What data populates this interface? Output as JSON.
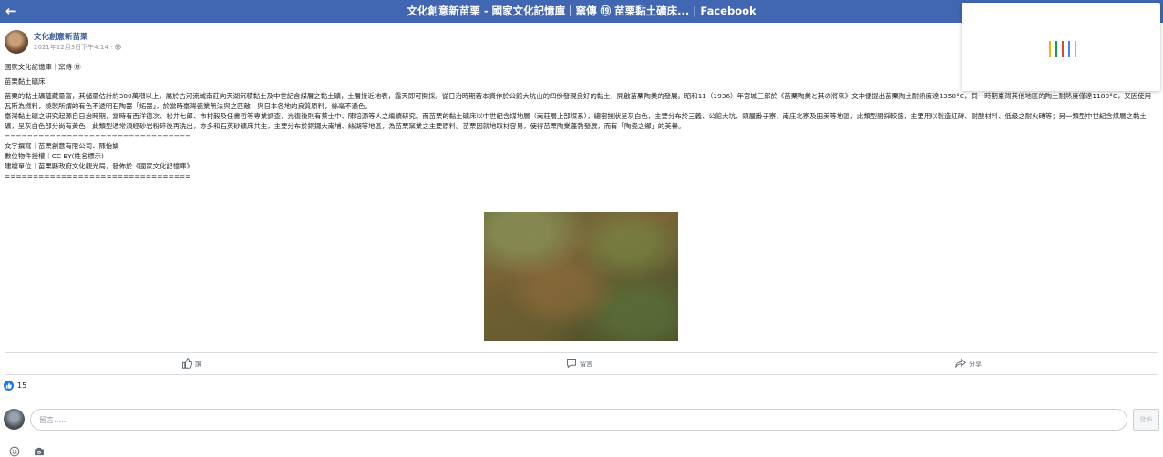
{
  "topbar": {
    "back_icon": "arrow-left-icon",
    "title": "文化創意新苗栗 - 國家文化記憶庫｜窯傳 ⑲ 苗栗黏土礦床... | Facebook",
    "background": "#4267b2"
  },
  "loader": {
    "colors": [
      "#f4b400",
      "#0f9d58",
      "#db4437",
      "#4285f4",
      "#f4b400"
    ]
  },
  "post": {
    "page_name": "文化創意新苗栗",
    "timestamp": "2021年12月3日下午4:14 · ",
    "privacy_icon": "globe-icon",
    "lines": [
      "國家文化記憶庫｜窯傳 ⑲",
      "苗栗黏土礦床",
      "苗栗的黏土礦蘊藏量富，其儲量估計約300萬噸以上，屬於古河流域南莊向天湖沉積黏土及中世紀含煤層之黏土礦，土層接近地表，露天即可開採。從日治時期若本資作於公館大坑山的四份發現良好的黏土，開啟苗栗陶業的發展。昭和11（1936）年宮城三郎於《苗栗陶業と其の將來》文中便提出苗栗陶土耐熱度達1350°C，同一時期臺灣其他地區的陶土耐熱度僅達1180°C，又因使用瓦斯為燃料，燒製所謂的有色不透明石陶器「炻器」，於當時臺灣瓷業無法與之匹敵，與日本各地的良質原料，絲毫不遜色。",
      "臺灣黏土礦之研究起源自日治時期，當時有西洋德次、松井七郎、市村毅及任書哲等專業調查，光復後則有蔡士中、陳培源等人之繼續研究。而苗栗的黏土礦床以中世紀含煤地層（南莊層上部煤系），總密撓狀呈灰白色，主要分布於三義、公館大坑、頭屋番子寮、南庄北寮及田美等地區，此類型開採較盛，主要用以製造紅磚、耐酸材料、低級之耐火磚等；另一類型中世紀含煤層之黏土礦，呈灰白色部分尚有黃色，此類型通常須經砂岩粉碎後再洗出，亦多和石英砂礦床共生，主要分布於銅鑼大南埔、絲湖等地區，為苗栗窯業之主要原料。苗栗因就地取材容易，使得苗栗陶業蓬勃發展，而有「陶瓷之鄉」的美譽。",
      "=================================",
      "文字撰寫｜苗栗創意有限公司．陳怡娟",
      "數位物件授權｜CC BY(姓名標示)",
      "建檔單位｜苗栗縣政府文化觀光局，發佈於《國家文化記憶庫》",
      "================================="
    ],
    "photo_alt": "苗栗黏土礦床"
  },
  "actions": {
    "like": "讚",
    "comment": "留言",
    "share": "分享",
    "like_icon": "thumbs-up-icon",
    "comment_icon": "speech-bubble-icon",
    "share_icon": "share-arrow-icon"
  },
  "reactions": {
    "like_count": "15",
    "icon": "like-badge-icon"
  },
  "comment_box": {
    "placeholder": "留言……",
    "submit_label": "發佈",
    "emoji_icon": "smiley-icon",
    "camera_icon": "camera-icon"
  }
}
